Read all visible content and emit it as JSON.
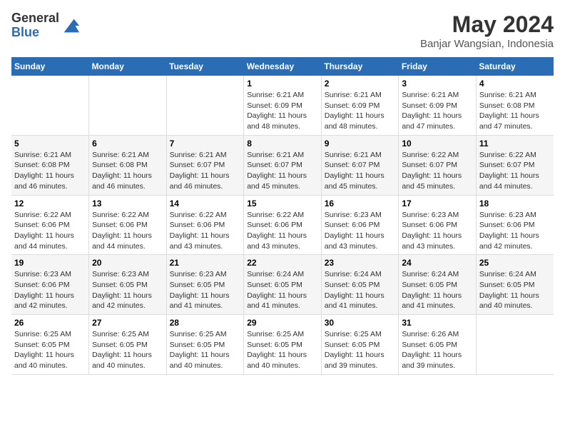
{
  "header": {
    "logo_line1": "General",
    "logo_line2": "Blue",
    "title": "May 2024",
    "subtitle": "Banjar Wangsian, Indonesia"
  },
  "calendar": {
    "days_of_week": [
      "Sunday",
      "Monday",
      "Tuesday",
      "Wednesday",
      "Thursday",
      "Friday",
      "Saturday"
    ],
    "weeks": [
      [
        {
          "day": "",
          "info": ""
        },
        {
          "day": "",
          "info": ""
        },
        {
          "day": "",
          "info": ""
        },
        {
          "day": "1",
          "info": "Sunrise: 6:21 AM\nSunset: 6:09 PM\nDaylight: 11 hours and 48 minutes."
        },
        {
          "day": "2",
          "info": "Sunrise: 6:21 AM\nSunset: 6:09 PM\nDaylight: 11 hours and 48 minutes."
        },
        {
          "day": "3",
          "info": "Sunrise: 6:21 AM\nSunset: 6:09 PM\nDaylight: 11 hours and 47 minutes."
        },
        {
          "day": "4",
          "info": "Sunrise: 6:21 AM\nSunset: 6:08 PM\nDaylight: 11 hours and 47 minutes."
        }
      ],
      [
        {
          "day": "5",
          "info": "Sunrise: 6:21 AM\nSunset: 6:08 PM\nDaylight: 11 hours and 46 minutes."
        },
        {
          "day": "6",
          "info": "Sunrise: 6:21 AM\nSunset: 6:08 PM\nDaylight: 11 hours and 46 minutes."
        },
        {
          "day": "7",
          "info": "Sunrise: 6:21 AM\nSunset: 6:07 PM\nDaylight: 11 hours and 46 minutes."
        },
        {
          "day": "8",
          "info": "Sunrise: 6:21 AM\nSunset: 6:07 PM\nDaylight: 11 hours and 45 minutes."
        },
        {
          "day": "9",
          "info": "Sunrise: 6:21 AM\nSunset: 6:07 PM\nDaylight: 11 hours and 45 minutes."
        },
        {
          "day": "10",
          "info": "Sunrise: 6:22 AM\nSunset: 6:07 PM\nDaylight: 11 hours and 45 minutes."
        },
        {
          "day": "11",
          "info": "Sunrise: 6:22 AM\nSunset: 6:07 PM\nDaylight: 11 hours and 44 minutes."
        }
      ],
      [
        {
          "day": "12",
          "info": "Sunrise: 6:22 AM\nSunset: 6:06 PM\nDaylight: 11 hours and 44 minutes."
        },
        {
          "day": "13",
          "info": "Sunrise: 6:22 AM\nSunset: 6:06 PM\nDaylight: 11 hours and 44 minutes."
        },
        {
          "day": "14",
          "info": "Sunrise: 6:22 AM\nSunset: 6:06 PM\nDaylight: 11 hours and 43 minutes."
        },
        {
          "day": "15",
          "info": "Sunrise: 6:22 AM\nSunset: 6:06 PM\nDaylight: 11 hours and 43 minutes."
        },
        {
          "day": "16",
          "info": "Sunrise: 6:23 AM\nSunset: 6:06 PM\nDaylight: 11 hours and 43 minutes."
        },
        {
          "day": "17",
          "info": "Sunrise: 6:23 AM\nSunset: 6:06 PM\nDaylight: 11 hours and 43 minutes."
        },
        {
          "day": "18",
          "info": "Sunrise: 6:23 AM\nSunset: 6:06 PM\nDaylight: 11 hours and 42 minutes."
        }
      ],
      [
        {
          "day": "19",
          "info": "Sunrise: 6:23 AM\nSunset: 6:06 PM\nDaylight: 11 hours and 42 minutes."
        },
        {
          "day": "20",
          "info": "Sunrise: 6:23 AM\nSunset: 6:05 PM\nDaylight: 11 hours and 42 minutes."
        },
        {
          "day": "21",
          "info": "Sunrise: 6:23 AM\nSunset: 6:05 PM\nDaylight: 11 hours and 41 minutes."
        },
        {
          "day": "22",
          "info": "Sunrise: 6:24 AM\nSunset: 6:05 PM\nDaylight: 11 hours and 41 minutes."
        },
        {
          "day": "23",
          "info": "Sunrise: 6:24 AM\nSunset: 6:05 PM\nDaylight: 11 hours and 41 minutes."
        },
        {
          "day": "24",
          "info": "Sunrise: 6:24 AM\nSunset: 6:05 PM\nDaylight: 11 hours and 41 minutes."
        },
        {
          "day": "25",
          "info": "Sunrise: 6:24 AM\nSunset: 6:05 PM\nDaylight: 11 hours and 40 minutes."
        }
      ],
      [
        {
          "day": "26",
          "info": "Sunrise: 6:25 AM\nSunset: 6:05 PM\nDaylight: 11 hours and 40 minutes."
        },
        {
          "day": "27",
          "info": "Sunrise: 6:25 AM\nSunset: 6:05 PM\nDaylight: 11 hours and 40 minutes."
        },
        {
          "day": "28",
          "info": "Sunrise: 6:25 AM\nSunset: 6:05 PM\nDaylight: 11 hours and 40 minutes."
        },
        {
          "day": "29",
          "info": "Sunrise: 6:25 AM\nSunset: 6:05 PM\nDaylight: 11 hours and 40 minutes."
        },
        {
          "day": "30",
          "info": "Sunrise: 6:25 AM\nSunset: 6:05 PM\nDaylight: 11 hours and 39 minutes."
        },
        {
          "day": "31",
          "info": "Sunrise: 6:26 AM\nSunset: 6:05 PM\nDaylight: 11 hours and 39 minutes."
        },
        {
          "day": "",
          "info": ""
        }
      ]
    ]
  }
}
